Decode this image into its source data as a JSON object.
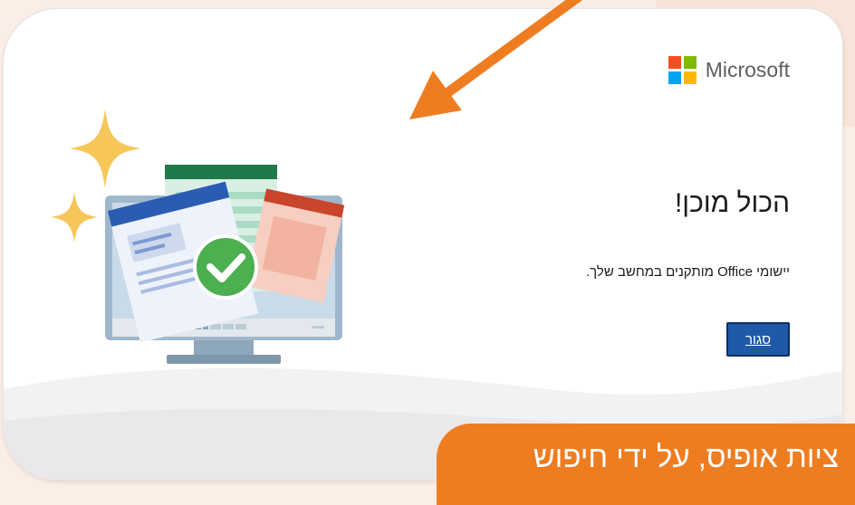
{
  "header": {
    "brand": "Microsoft"
  },
  "dialog": {
    "title": "הכול מוכן!",
    "message": "יישומי Office מותקנים במחשב שלך.",
    "close_label": "סגור"
  },
  "banner": {
    "text": "ציות אופיס, על ידי חיפוש"
  },
  "colors": {
    "accent_orange": "#ee7d22",
    "button_blue": "#1f5aa8",
    "check_green": "#4caf50",
    "ms_red": "#f25022",
    "ms_green": "#7fba00",
    "ms_blue": "#00a4ef",
    "ms_yellow": "#ffb900"
  },
  "icons": [
    "microsoft-logo-icon",
    "sparkle-icon",
    "computer-illustration",
    "checkmark-icon",
    "arrow-icon"
  ]
}
